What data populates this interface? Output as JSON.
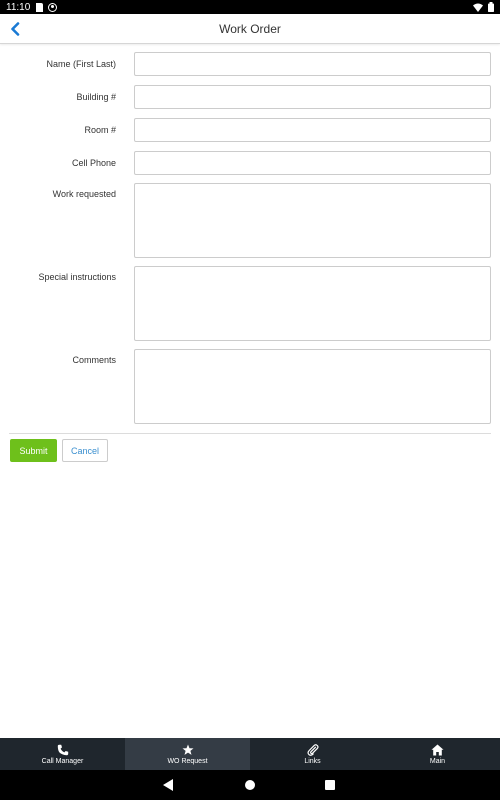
{
  "status_bar": {
    "time": "11:10",
    "icons": [
      "sd-card-icon",
      "at-sign-icon",
      "wifi-icon",
      "battery-icon"
    ]
  },
  "header": {
    "title": "Work Order",
    "back_icon": "chevron-left-icon",
    "accent": "#1a7ad4"
  },
  "form": {
    "fields": [
      {
        "label": "Name (First Last)",
        "value": ""
      },
      {
        "label": "Building #",
        "value": ""
      },
      {
        "label": "Room #",
        "value": ""
      },
      {
        "label": "Cell Phone",
        "value": ""
      },
      {
        "label": "Work requested",
        "value": ""
      },
      {
        "label": "Special instructions",
        "value": ""
      },
      {
        "label": "Comments",
        "value": ""
      }
    ],
    "submit_label": "Submit",
    "cancel_label": "Cancel",
    "submit_color": "#6ec01b",
    "cancel_color": "#3a8fcf"
  },
  "tabbar": {
    "tabs": [
      {
        "label": "Call Manager",
        "icon": "phone-icon",
        "active": false
      },
      {
        "label": "WO Request",
        "icon": "star-icon",
        "active": true
      },
      {
        "label": "Links",
        "icon": "paperclip-icon",
        "active": false
      },
      {
        "label": "Main",
        "icon": "home-icon",
        "active": false
      }
    ]
  }
}
